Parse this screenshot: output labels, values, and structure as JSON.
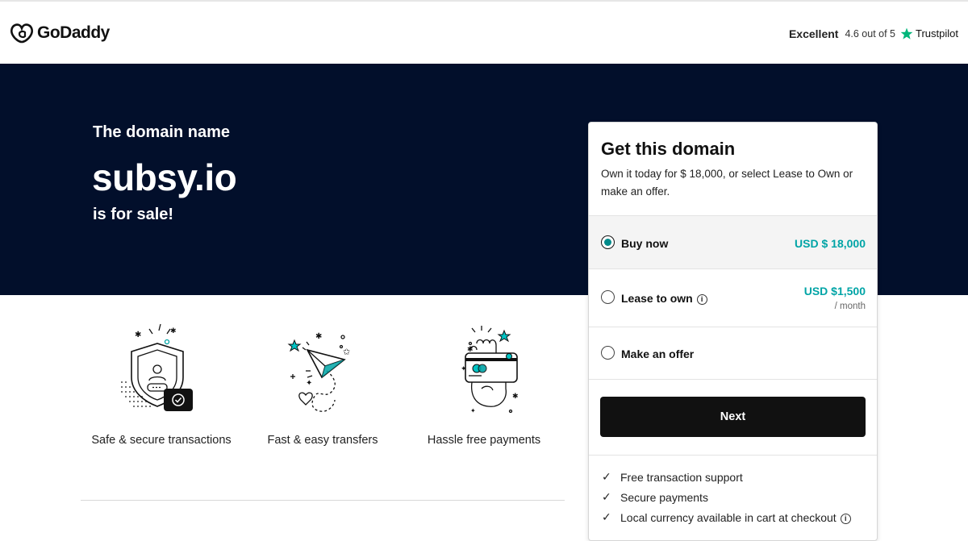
{
  "header": {
    "logo_text": "GoDaddy",
    "trust_excellent": "Excellent",
    "trust_rating": "4.6 out of 5",
    "trust_brand": "Trustpilot"
  },
  "hero": {
    "subtitle": "The domain name",
    "domain": "subsy.io",
    "sale_text": "is for sale!"
  },
  "features": [
    {
      "label": "Safe & secure transactions",
      "icon": "shield-icon"
    },
    {
      "label": "Fast & easy transfers",
      "icon": "paper-plane-icon"
    },
    {
      "label": "Hassle free payments",
      "icon": "card-hand-icon"
    }
  ],
  "card": {
    "title": "Get this domain",
    "description": "Own it today for $ 18,000, or select Lease to Own or make an offer.",
    "options": [
      {
        "label": "Buy now",
        "price": "USD $ 18,000",
        "selected": true
      },
      {
        "label": "Lease to own",
        "price": "USD $1,500",
        "period": "/ month",
        "selected": false
      },
      {
        "label": "Make an offer",
        "selected": false
      }
    ],
    "next_label": "Next",
    "perks": [
      "Free transaction support",
      "Secure payments",
      "Local currency available in cart at checkout"
    ]
  },
  "colors": {
    "hero_bg": "#020f2b",
    "accent_teal": "#00a4a6",
    "button_bg": "#111111",
    "trustpilot_green": "#00b67a"
  }
}
